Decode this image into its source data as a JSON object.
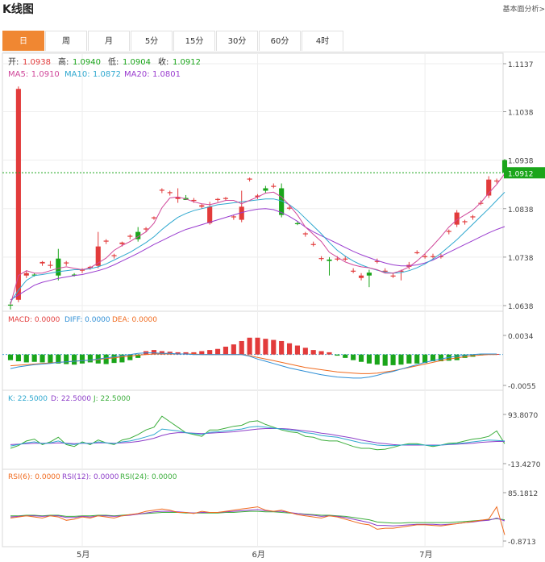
{
  "header": {
    "title": "K线图",
    "link": "基本面分析>"
  },
  "tabs": [
    {
      "label": "日",
      "active": true
    },
    {
      "label": "周",
      "active": false
    },
    {
      "label": "月",
      "active": false
    },
    {
      "label": "5分",
      "active": false
    },
    {
      "label": "15分",
      "active": false
    },
    {
      "label": "30分",
      "active": false
    },
    {
      "label": "60分",
      "active": false
    },
    {
      "label": "4时",
      "active": false
    }
  ],
  "colors": {
    "up": "#e23b3b",
    "down": "#1aa51a",
    "ma5": "#d0479a",
    "ma10": "#2fa8cf",
    "ma20": "#9a3ccf"
  },
  "chart_data": {
    "type": "candlestick",
    "ohlc_label": {
      "open": {
        "label": "开:",
        "value": "1.0938"
      },
      "high": {
        "label": "高:",
        "value": "1.0940"
      },
      "low": {
        "label": "低:",
        "value": "1.0904"
      },
      "close": {
        "label": "收:",
        "value": "1.0912"
      }
    },
    "ma_label": {
      "ma5": {
        "label": "MA5:",
        "value": "1.0910"
      },
      "ma10": {
        "label": "MA10:",
        "value": "1.0872"
      },
      "ma20": {
        "label": "MA20:",
        "value": "1.0801"
      }
    },
    "price_axis": {
      "ticks": [
        "1.1137",
        "1.1038",
        "1.0938",
        "1.0838",
        "1.0738",
        "1.0638"
      ],
      "ylim": [
        1.0638,
        1.1137
      ]
    },
    "current_price": "1.0912",
    "x_labels": [
      {
        "label": "5月",
        "index": 9
      },
      {
        "label": "6月",
        "index": 31
      },
      {
        "label": "7月",
        "index": 52
      }
    ],
    "candles": [
      {
        "o": 1.064,
        "h": 1.0645,
        "l": 1.063,
        "c": 1.0638
      },
      {
        "o": 1.065,
        "h": 1.109,
        "l": 1.0645,
        "c": 1.1085
      },
      {
        "o": 1.07,
        "h": 1.071,
        "l": 1.0695,
        "c": 1.0705
      },
      {
        "o": 1.0702,
        "h": 1.0705,
        "l": 1.0698,
        "c": 1.07
      },
      {
        "o": 1.0725,
        "h": 1.073,
        "l": 1.072,
        "c": 1.0728
      },
      {
        "o": 1.072,
        "h": 1.073,
        "l": 1.0715,
        "c": 1.0722
      },
      {
        "o": 1.0735,
        "h": 1.0755,
        "l": 1.069,
        "c": 1.07
      },
      {
        "o": 1.0725,
        "h": 1.073,
        "l": 1.072,
        "c": 1.0727
      },
      {
        "o": 1.0702,
        "h": 1.0705,
        "l": 1.0698,
        "c": 1.07
      },
      {
        "o": 1.071,
        "h": 1.0715,
        "l": 1.0705,
        "c": 1.0712
      },
      {
        "o": 1.0716,
        "h": 1.072,
        "l": 1.0712,
        "c": 1.0718
      },
      {
        "o": 1.072,
        "h": 1.079,
        "l": 1.0715,
        "c": 1.076
      },
      {
        "o": 1.077,
        "h": 1.0775,
        "l": 1.0765,
        "c": 1.0772
      },
      {
        "o": 1.074,
        "h": 1.0745,
        "l": 1.0735,
        "c": 1.0742
      },
      {
        "o": 1.0765,
        "h": 1.077,
        "l": 1.076,
        "c": 1.0768
      },
      {
        "o": 1.078,
        "h": 1.0785,
        "l": 1.0775,
        "c": 1.0782
      },
      {
        "o": 1.079,
        "h": 1.08,
        "l": 1.077,
        "c": 1.0775
      },
      {
        "o": 1.0795,
        "h": 1.08,
        "l": 1.079,
        "c": 1.0797
      },
      {
        "o": 1.0818,
        "h": 1.0822,
        "l": 1.0815,
        "c": 1.082
      },
      {
        "o": 1.0875,
        "h": 1.088,
        "l": 1.087,
        "c": 1.0877
      },
      {
        "o": 1.087,
        "h": 1.0875,
        "l": 1.0865,
        "c": 1.0872
      },
      {
        "o": 1.0858,
        "h": 1.088,
        "l": 1.085,
        "c": 1.0862
      },
      {
        "o": 1.086,
        "h": 1.0866,
        "l": 1.0856,
        "c": 1.0856
      },
      {
        "o": 1.0855,
        "h": 1.086,
        "l": 1.085,
        "c": 1.0856
      },
      {
        "o": 1.0842,
        "h": 1.0848,
        "l": 1.0838,
        "c": 1.0845
      },
      {
        "o": 1.0808,
        "h": 1.0852,
        "l": 1.0805,
        "c": 1.0842
      },
      {
        "o": 1.0856,
        "h": 1.086,
        "l": 1.0852,
        "c": 1.0858
      },
      {
        "o": 1.0858,
        "h": 1.0862,
        "l": 1.0854,
        "c": 1.086
      },
      {
        "o": 1.082,
        "h": 1.0825,
        "l": 1.0815,
        "c": 1.0822
      },
      {
        "o": 1.0815,
        "h": 1.0875,
        "l": 1.081,
        "c": 1.0842
      },
      {
        "o": 1.0898,
        "h": 1.0902,
        "l": 1.0894,
        "c": 1.09
      },
      {
        "o": 1.0862,
        "h": 1.0868,
        "l": 1.0858,
        "c": 1.0865
      },
      {
        "o": 1.088,
        "h": 1.0885,
        "l": 1.087,
        "c": 1.0875
      },
      {
        "o": 1.0885,
        "h": 1.089,
        "l": 1.088,
        "c": 1.0885
      },
      {
        "o": 1.088,
        "h": 1.089,
        "l": 1.082,
        "c": 1.0825
      },
      {
        "o": 1.084,
        "h": 1.0845,
        "l": 1.0835,
        "c": 1.084
      },
      {
        "o": 1.0808,
        "h": 1.0812,
        "l": 1.0804,
        "c": 1.0806
      },
      {
        "o": 1.0785,
        "h": 1.079,
        "l": 1.078,
        "c": 1.0787
      },
      {
        "o": 1.0765,
        "h": 1.077,
        "l": 1.076,
        "c": 1.0765
      },
      {
        "o": 1.0735,
        "h": 1.074,
        "l": 1.073,
        "c": 1.0736
      },
      {
        "o": 1.0733,
        "h": 1.0738,
        "l": 1.07,
        "c": 1.073
      },
      {
        "o": 1.0735,
        "h": 1.074,
        "l": 1.073,
        "c": 1.0735
      },
      {
        "o": 1.0735,
        "h": 1.074,
        "l": 1.073,
        "c": 1.0735
      },
      {
        "o": 1.071,
        "h": 1.0715,
        "l": 1.0705,
        "c": 1.071
      },
      {
        "o": 1.0695,
        "h": 1.0705,
        "l": 1.069,
        "c": 1.07
      },
      {
        "o": 1.0706,
        "h": 1.0712,
        "l": 1.0676,
        "c": 1.07
      },
      {
        "o": 1.073,
        "h": 1.0735,
        "l": 1.0725,
        "c": 1.073
      },
      {
        "o": 1.071,
        "h": 1.0715,
        "l": 1.0705,
        "c": 1.071
      },
      {
        "o": 1.07,
        "h": 1.0705,
        "l": 1.0695,
        "c": 1.07
      },
      {
        "o": 1.0708,
        "h": 1.0712,
        "l": 1.069,
        "c": 1.071
      },
      {
        "o": 1.0718,
        "h": 1.0728,
        "l": 1.0713,
        "c": 1.0722
      },
      {
        "o": 1.0748,
        "h": 1.0752,
        "l": 1.0744,
        "c": 1.0748
      },
      {
        "o": 1.074,
        "h": 1.0745,
        "l": 1.0735,
        "c": 1.074
      },
      {
        "o": 1.074,
        "h": 1.0745,
        "l": 1.0735,
        "c": 1.074
      },
      {
        "o": 1.074,
        "h": 1.0745,
        "l": 1.0735,
        "c": 1.074
      },
      {
        "o": 1.079,
        "h": 1.0795,
        "l": 1.0785,
        "c": 1.0792
      },
      {
        "o": 1.0805,
        "h": 1.0835,
        "l": 1.08,
        "c": 1.083
      },
      {
        "o": 1.081,
        "h": 1.0815,
        "l": 1.0805,
        "c": 1.0812
      },
      {
        "o": 1.082,
        "h": 1.0825,
        "l": 1.0815,
        "c": 1.0822
      },
      {
        "o": 1.085,
        "h": 1.0855,
        "l": 1.0845,
        "c": 1.085
      },
      {
        "o": 1.0865,
        "h": 1.0905,
        "l": 1.086,
        "c": 1.0898
      },
      {
        "o": 1.0895,
        "h": 1.09,
        "l": 1.089,
        "c": 1.0896
      },
      {
        "o": 1.0938,
        "h": 1.094,
        "l": 1.0904,
        "c": 1.0912
      }
    ],
    "ma_lines": {
      "ma5": [
        1.064,
        1.07,
        1.071,
        1.0705,
        1.0705,
        1.071,
        1.0715,
        1.0718,
        1.0715,
        1.0712,
        1.0716,
        1.0726,
        1.0736,
        1.0752,
        1.0762,
        1.077,
        1.078,
        1.079,
        1.0808,
        1.084,
        1.086,
        1.0862,
        1.0858,
        1.0852,
        1.0848,
        1.0846,
        1.085,
        1.0855,
        1.0855,
        1.0848,
        1.0855,
        1.0862,
        1.087,
        1.0872,
        1.0862,
        1.0845,
        1.0825,
        1.08,
        1.0785,
        1.077,
        1.0748,
        1.0738,
        1.0728,
        1.0722,
        1.0718,
        1.0716,
        1.0712,
        1.0705,
        1.0705,
        1.071,
        1.0718,
        1.073,
        1.0745,
        1.0762,
        1.078,
        1.08,
        1.0815,
        1.0825,
        1.0835,
        1.085,
        1.087,
        1.0888,
        1.091
      ],
      "ma10": [
        1.0645,
        1.067,
        1.069,
        1.07,
        1.0702,
        1.0705,
        1.0708,
        1.071,
        1.0712,
        1.0712,
        1.0714,
        1.0718,
        1.0724,
        1.0732,
        1.074,
        1.0748,
        1.0758,
        1.0768,
        1.078,
        1.0795,
        1.0808,
        1.082,
        1.0828,
        1.0834,
        1.0838,
        1.0842,
        1.0846,
        1.0848,
        1.085,
        1.0852,
        1.0854,
        1.0856,
        1.0858,
        1.0858,
        1.0854,
        1.0846,
        1.0834,
        1.0818,
        1.0802,
        1.0786,
        1.0768,
        1.0752,
        1.074,
        1.073,
        1.0722,
        1.0716,
        1.0711,
        1.0707,
        1.0705,
        1.0706,
        1.071,
        1.0716,
        1.0724,
        1.0734,
        1.0746,
        1.076,
        1.0774,
        1.079,
        1.0806,
        1.0822,
        1.0838,
        1.0855,
        1.0872
      ],
      "ma20": [
        1.065,
        1.066,
        1.067,
        1.068,
        1.0686,
        1.069,
        1.0694,
        1.0697,
        1.07,
        1.0702,
        1.0706,
        1.071,
        1.0715,
        1.0722,
        1.073,
        1.0738,
        1.0746,
        1.0755,
        1.0764,
        1.0772,
        1.078,
        1.0788,
        1.0795,
        1.08,
        1.0805,
        1.081,
        1.0815,
        1.082,
        1.0825,
        1.083,
        1.0834,
        1.0837,
        1.0838,
        1.0836,
        1.083,
        1.0822,
        1.0812,
        1.08,
        1.079,
        1.0782,
        1.0774,
        1.0766,
        1.0758,
        1.075,
        1.0743,
        1.0737,
        1.0731,
        1.0726,
        1.0722,
        1.072,
        1.072,
        1.0722,
        1.0726,
        1.0732,
        1.074,
        1.0748,
        1.0756,
        1.0764,
        1.0772,
        1.078,
        1.0788,
        1.0795,
        1.0801
      ]
    },
    "macd": {
      "labels": {
        "macd": "MACD: 0.0000",
        "diff": "DIFF: 0.0000",
        "dea": "DEA: 0.0000"
      },
      "ticks": [
        "0.0034",
        "-0.0055"
      ],
      "ylim": [
        -0.0055,
        0.0034
      ],
      "hist": [
        -0.001,
        -0.0012,
        -0.0014,
        -0.0013,
        -0.0014,
        -0.0015,
        -0.0016,
        -0.0017,
        -0.0018,
        -0.0016,
        -0.0014,
        -0.0016,
        -0.0017,
        -0.0015,
        -0.0014,
        -0.001,
        -0.0006,
        0.0006,
        0.0008,
        0.0006,
        0.0005,
        0.0004,
        0.0004,
        0.0004,
        0.0006,
        0.0008,
        0.001,
        0.0014,
        0.0018,
        0.0024,
        0.003,
        0.003,
        0.0028,
        0.0026,
        0.0024,
        0.002,
        0.0016,
        0.0012,
        0.0008,
        0.0006,
        0.0004,
        -0.0002,
        -0.0006,
        -0.001,
        -0.0013,
        -0.0016,
        -0.0018,
        -0.002,
        -0.0019,
        -0.0018,
        -0.0016,
        -0.0016,
        -0.0015,
        -0.0012,
        -0.0012,
        -0.0011,
        -0.001,
        -0.0006,
        -0.0004,
        -0.0001,
        0.0001,
        0.0001
      ],
      "diff": [
        -0.0025,
        -0.0022,
        -0.002,
        -0.0018,
        -0.0017,
        -0.0016,
        -0.0014,
        -0.0013,
        -0.0012,
        -0.0011,
        -0.001,
        -0.0008,
        -0.0006,
        -0.0004,
        -0.0002,
        0.0,
        0.0002,
        0.0003,
        0.0003,
        0.0002,
        0.0002,
        0.0001,
        0.0001,
        0.0,
        0.0,
        0.0,
        0.0,
        0.0,
        0.0,
        0.0,
        -0.0003,
        -0.0008,
        -0.0012,
        -0.0016,
        -0.002,
        -0.0024,
        -0.0027,
        -0.003,
        -0.0033,
        -0.0036,
        -0.0038,
        -0.004,
        -0.0041,
        -0.0042,
        -0.0042,
        -0.004,
        -0.0037,
        -0.0033,
        -0.003,
        -0.0026,
        -0.0022,
        -0.0018,
        -0.0014,
        -0.0011,
        -0.0008,
        -0.0005,
        -0.0003,
        -0.0001,
        0.0,
        0.0001,
        0.0001,
        0.0001
      ],
      "dea": [
        -0.002,
        -0.0019,
        -0.0018,
        -0.0017,
        -0.0016,
        -0.0015,
        -0.0014,
        -0.0013,
        -0.0012,
        -0.0011,
        -0.001,
        -0.0009,
        -0.0007,
        -0.0006,
        -0.0004,
        -0.0003,
        -0.0001,
        0.0,
        0.0001,
        0.0001,
        0.0001,
        0.0001,
        0.0001,
        0.0001,
        0.0,
        0.0,
        0.0,
        0.0,
        0.0,
        0.0,
        -0.0002,
        -0.0005,
        -0.0008,
        -0.0011,
        -0.0014,
        -0.0017,
        -0.002,
        -0.0023,
        -0.0025,
        -0.0027,
        -0.0029,
        -0.0031,
        -0.0032,
        -0.0033,
        -0.0034,
        -0.0034,
        -0.0033,
        -0.0031,
        -0.0029,
        -0.0026,
        -0.0023,
        -0.002,
        -0.0017,
        -0.0014,
        -0.0011,
        -0.0008,
        -0.0006,
        -0.0004,
        -0.0002,
        -0.0001,
        0.0,
        0.0
      ]
    },
    "kdj": {
      "labels": {
        "k": "K: 22.5000",
        "d": "D: 22.5000",
        "j": "J: 22.5000"
      },
      "ticks": [
        "93.8070",
        "-13.4270"
      ],
      "ylim": [
        -13.427,
        93.807
      ],
      "k": [
        25,
        28,
        32,
        34,
        30,
        32,
        36,
        30,
        28,
        32,
        30,
        34,
        32,
        30,
        34,
        36,
        40,
        45,
        50,
        62,
        60,
        58,
        54,
        52,
        50,
        55,
        56,
        58,
        60,
        62,
        66,
        68,
        66,
        64,
        62,
        60,
        58,
        54,
        52,
        48,
        46,
        44,
        40,
        36,
        32,
        30,
        27,
        26,
        26,
        27,
        28,
        28,
        27,
        26,
        27,
        29,
        30,
        32,
        34,
        36,
        38,
        37,
        36
      ],
      "d": [
        28,
        29,
        30,
        31,
        31,
        31,
        32,
        31,
        30,
        31,
        31,
        32,
        32,
        31,
        32,
        33,
        35,
        38,
        42,
        48,
        52,
        54,
        54,
        53,
        52,
        53,
        54,
        55,
        56,
        58,
        60,
        62,
        63,
        63,
        63,
        62,
        60,
        58,
        56,
        53,
        51,
        48,
        45,
        42,
        38,
        35,
        32,
        30,
        28,
        27,
        27,
        27,
        27,
        27,
        27,
        28,
        29,
        30,
        31,
        33,
        34,
        35,
        35
      ],
      "j": [
        20,
        26,
        36,
        40,
        28,
        34,
        44,
        28,
        24,
        34,
        28,
        38,
        32,
        28,
        38,
        42,
        50,
        60,
        66,
        90,
        78,
        66,
        54,
        50,
        46,
        60,
        60,
        64,
        68,
        70,
        78,
        80,
        72,
        66,
        60,
        56,
        54,
        46,
        44,
        38,
        36,
        36,
        30,
        24,
        20,
        20,
        17,
        18,
        22,
        27,
        30,
        30,
        27,
        24,
        27,
        31,
        32,
        36,
        40,
        42,
        46,
        58,
        30
      ]
    },
    "rsi": {
      "labels": {
        "rsi6": "RSI(6): 0.0000",
        "rsi12": "RSI(12): 0.0000",
        "rsi24": "RSI(24): 0.0000"
      },
      "ticks": [
        "85.1812",
        "-0.8713"
      ],
      "ylim": [
        -0.8713,
        85.1812
      ],
      "rsi6": [
        40,
        42,
        44,
        42,
        40,
        44,
        42,
        36,
        38,
        42,
        40,
        44,
        42,
        40,
        44,
        46,
        48,
        52,
        54,
        56,
        54,
        50,
        50,
        48,
        52,
        50,
        50,
        52,
        54,
        56,
        58,
        60,
        54,
        52,
        54,
        50,
        46,
        44,
        42,
        40,
        44,
        42,
        38,
        34,
        30,
        28,
        20,
        22,
        22,
        24,
        26,
        28,
        28,
        27,
        26,
        28,
        30,
        32,
        34,
        36,
        38,
        60,
        10
      ],
      "rsi12": [
        42,
        43,
        44,
        44,
        43,
        44,
        44,
        41,
        41,
        43,
        42,
        44,
        44,
        43,
        44,
        45,
        47,
        49,
        51,
        52,
        52,
        51,
        50,
        49,
        50,
        50,
        50,
        51,
        52,
        53,
        54,
        55,
        53,
        52,
        52,
        50,
        48,
        46,
        45,
        43,
        44,
        43,
        41,
        38,
        35,
        32,
        27,
        27,
        26,
        27,
        28,
        29,
        29,
        29,
        28,
        29,
        30,
        32,
        33,
        35,
        36,
        40,
        35
      ],
      "rsi24": [
        44,
        44,
        45,
        45,
        44,
        45,
        45,
        43,
        43,
        44,
        44,
        45,
        45,
        44,
        45,
        46,
        47,
        48,
        49,
        50,
        50,
        50,
        49,
        49,
        49,
        49,
        49,
        50,
        50,
        51,
        52,
        52,
        51,
        51,
        50,
        49,
        48,
        47,
        46,
        45,
        45,
        44,
        43,
        41,
        39,
        37,
        33,
        32,
        31,
        31,
        32,
        32,
        32,
        32,
        32,
        32,
        33,
        34,
        35,
        36,
        37,
        39,
        37
      ]
    }
  }
}
